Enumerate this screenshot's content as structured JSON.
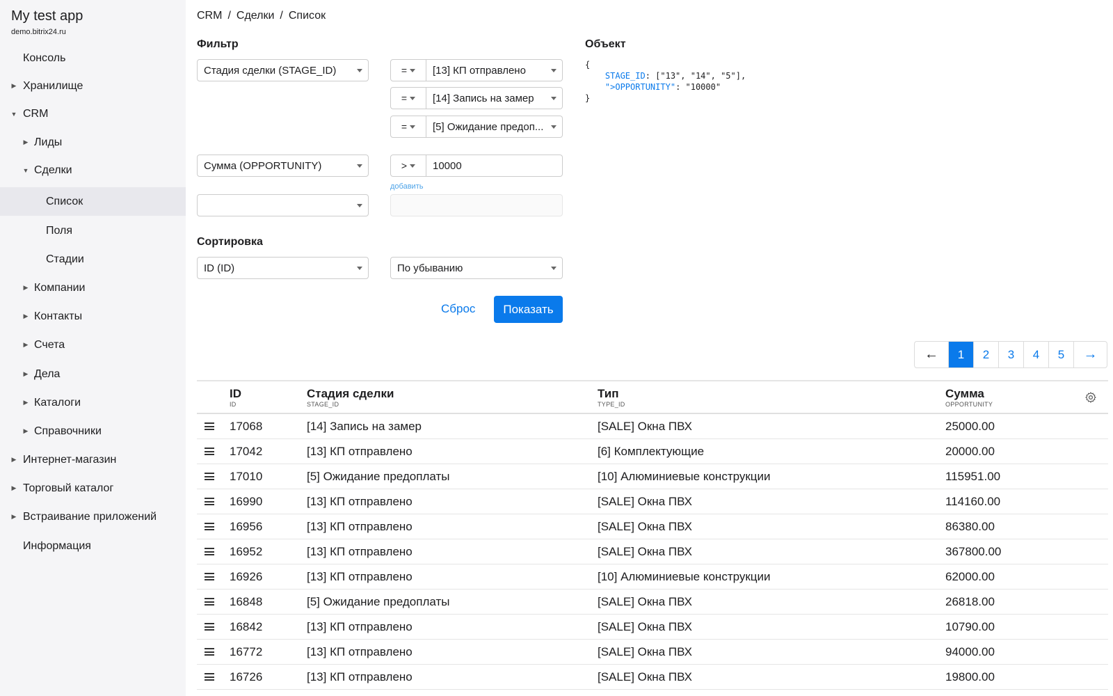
{
  "app": {
    "title": "My test app",
    "domain": "demo.bitrix24.ru"
  },
  "sidebar": {
    "items": [
      {
        "label": "Консоль",
        "arrow": ""
      },
      {
        "label": "Хранилище",
        "arrow": "▶"
      },
      {
        "label": "CRM",
        "arrow": "▼"
      },
      {
        "label": "Лиды",
        "arrow": "▶"
      },
      {
        "label": "Сделки",
        "arrow": "▼"
      },
      {
        "label": "Список",
        "arrow": ""
      },
      {
        "label": "Поля",
        "arrow": ""
      },
      {
        "label": "Стадии",
        "arrow": ""
      },
      {
        "label": "Компании",
        "arrow": "▶"
      },
      {
        "label": "Контакты",
        "arrow": "▶"
      },
      {
        "label": "Счета",
        "arrow": "▶"
      },
      {
        "label": "Дела",
        "arrow": "▶"
      },
      {
        "label": "Каталоги",
        "arrow": "▶"
      },
      {
        "label": "Справочники",
        "arrow": "▶"
      },
      {
        "label": "Интернет-магазин",
        "arrow": "▶"
      },
      {
        "label": "Торговый каталог",
        "arrow": "▶"
      },
      {
        "label": "Встраивание приложений",
        "arrow": "▶"
      },
      {
        "label": "Информация",
        "arrow": ""
      }
    ]
  },
  "breadcrumb": {
    "items": [
      "CRM",
      "Сделки",
      "Список"
    ],
    "separator": "/"
  },
  "filter": {
    "title": "Фильтр",
    "field1": "Стадия сделки (STAGE_ID)",
    "stage_conditions": [
      {
        "op": "=",
        "value": "[13] КП отправлено"
      },
      {
        "op": "=",
        "value": "[14] Запись на замер"
      },
      {
        "op": "=",
        "value": "[5] Ожидание предоп..."
      }
    ],
    "field2": "Сумма (OPPORTUNITY)",
    "amount_condition": {
      "op": ">",
      "value": "10000"
    },
    "add_label": "добавить",
    "field3": ""
  },
  "sort": {
    "title": "Сортировка",
    "field": "ID (ID)",
    "order": "По убыванию"
  },
  "actions": {
    "reset": "Сброс",
    "show": "Показать"
  },
  "object": {
    "title": "Объект",
    "open": "{",
    "line1_key": "STAGE_ID",
    "line1_rest": ": [\"13\", \"14\", \"5\"],",
    "line2_key": "\">OPPORTUNITY\"",
    "line2_rest": ": \"10000\"",
    "close": "}"
  },
  "pagination": {
    "prev": "←",
    "next": "→",
    "pages": [
      "1",
      "2",
      "3",
      "4",
      "5"
    ],
    "active": "1"
  },
  "table": {
    "columns": [
      {
        "label": "ID",
        "code": "ID"
      },
      {
        "label": "Стадия сделки",
        "code": "STAGE_ID"
      },
      {
        "label": "Тип",
        "code": "TYPE_ID"
      },
      {
        "label": "Сумма",
        "code": "OPPORTUNITY"
      }
    ],
    "rows": [
      [
        "17068",
        "[14] Запись на замер",
        "[SALE] Окна ПВХ",
        "25000.00"
      ],
      [
        "17042",
        "[13] КП отправлено",
        "[6] Комплектующие",
        "20000.00"
      ],
      [
        "17010",
        "[5] Ожидание предоплаты",
        "[10] Алюминиевые конструкции",
        "115951.00"
      ],
      [
        "16990",
        "[13] КП отправлено",
        "[SALE] Окна ПВХ",
        "114160.00"
      ],
      [
        "16956",
        "[13] КП отправлено",
        "[SALE] Окна ПВХ",
        "86380.00"
      ],
      [
        "16952",
        "[13] КП отправлено",
        "[SALE] Окна ПВХ",
        "367800.00"
      ],
      [
        "16926",
        "[13] КП отправлено",
        "[10] Алюминиевые конструкции",
        "62000.00"
      ],
      [
        "16848",
        "[5] Ожидание предоплаты",
        "[SALE] Окна ПВХ",
        "26818.00"
      ],
      [
        "16842",
        "[13] КП отправлено",
        "[SALE] Окна ПВХ",
        "10790.00"
      ],
      [
        "16772",
        "[13] КП отправлено",
        "[SALE] Окна ПВХ",
        "94000.00"
      ],
      [
        "16726",
        "[13] КП отправлено",
        "[SALE] Окна ПВХ",
        "19800.00"
      ]
    ]
  },
  "colors": {
    "accent": "#0a7aeb",
    "sidebar_bg": "#f5f5f7",
    "sidebar_active": "#e8e8ed"
  },
  "icons": {
    "settings": "gear-icon",
    "row_handle": "drag-handle-icon"
  }
}
